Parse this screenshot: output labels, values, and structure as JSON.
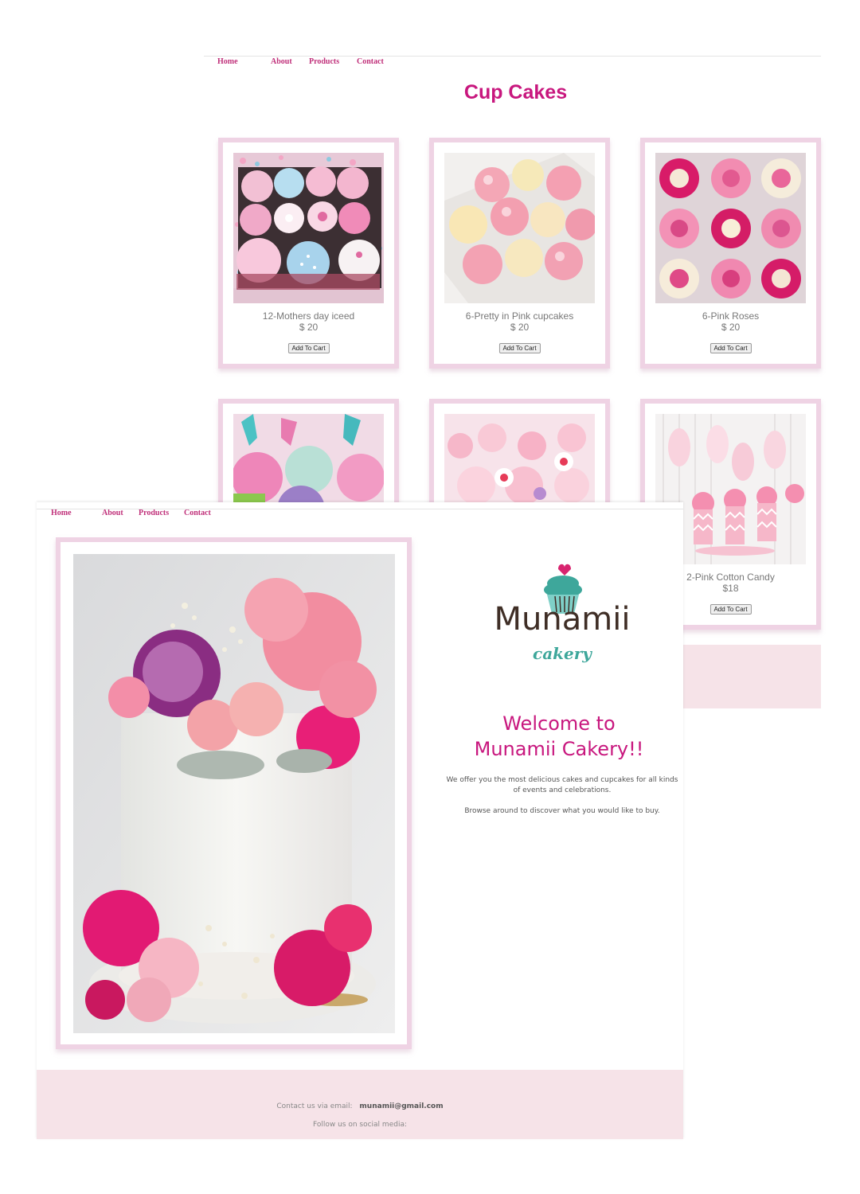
{
  "products_page": {
    "nav": [
      "Home",
      "About",
      "Products",
      "Contact"
    ],
    "title": "Cup Cakes",
    "products": [
      {
        "name": "12-Mothers day iceed",
        "price": "$ 20",
        "button": "Add To Cart"
      },
      {
        "name": "6-Pretty in Pink cupcakes",
        "price": "$ 20",
        "button": "Add To Cart"
      },
      {
        "name": "6-Pink Roses",
        "price": "$ 20",
        "button": "Add To Cart"
      },
      {
        "name": "",
        "price": "",
        "button": ""
      },
      {
        "name": "",
        "price": "",
        "button": ""
      },
      {
        "name": "2-Pink Cotton Candy",
        "price": "$18",
        "button": "Add To Cart"
      }
    ]
  },
  "home_page": {
    "nav": [
      "Home",
      "About",
      "Products",
      "Contact"
    ],
    "logo": {
      "name": "Munamii",
      "sub": "cakery"
    },
    "welcome_line1": "Welcome to",
    "welcome_line2": "Munamii Cakery!!",
    "intro": "We offer you the most delicious cakes and cupcakes for all kinds of events and celebrations.",
    "browse": "Browse around to discover what you would like to buy.",
    "footer": {
      "contact_label": "Contact us via email:",
      "email": "munamii@gmail.com",
      "social_label": "Follow us on social media:"
    }
  },
  "colors": {
    "accent": "#c8177e",
    "frame": "#efd3e4",
    "band": "#f6e3e8",
    "logo_teal": "#3ea79b"
  }
}
